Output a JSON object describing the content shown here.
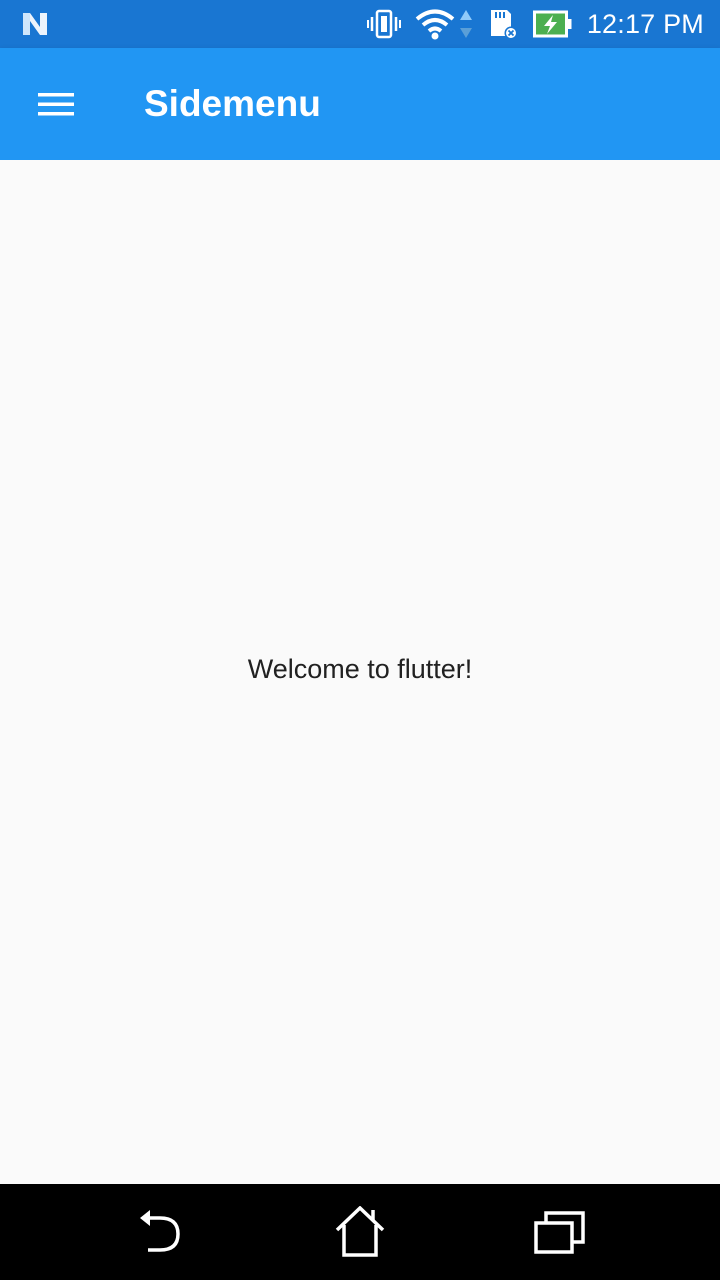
{
  "status_bar": {
    "time": "12:17 PM",
    "icons": [
      "notification-n-icon",
      "vibrate-icon",
      "wifi-icon",
      "data-arrows-icon",
      "sd-card-icon",
      "battery-charging-icon"
    ],
    "background_color": "#1976d2"
  },
  "app_bar": {
    "title": "Sidemenu",
    "menu_icon": "hamburger-menu-icon",
    "background_color": "#2196f3"
  },
  "body": {
    "message": "Welcome to flutter!"
  },
  "nav_bar": {
    "buttons": [
      "back-icon",
      "home-icon",
      "recents-icon"
    ]
  }
}
